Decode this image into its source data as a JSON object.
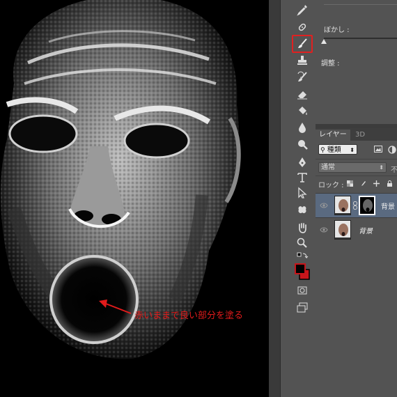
{
  "canvas": {
    "annotation": "赤いままで良い部分を塗る",
    "annotation_color": "#e21b1b"
  },
  "tools": [
    {
      "icon": "eyedropper-icon"
    },
    {
      "icon": "healing-brush-icon"
    },
    {
      "icon": "brush-icon",
      "active": true
    },
    {
      "icon": "clone-stamp-icon"
    },
    {
      "icon": "history-brush-icon"
    },
    {
      "icon": "eraser-icon"
    },
    {
      "icon": "paint-bucket-icon"
    },
    {
      "icon": "blur-drop-icon"
    },
    {
      "icon": "dodge-icon"
    },
    {
      "icon": "pen-icon"
    },
    {
      "icon": "type-icon"
    },
    {
      "icon": "path-selection-icon"
    },
    {
      "icon": "custom-shape-icon"
    },
    {
      "icon": "hand-icon"
    },
    {
      "icon": "zoom-icon"
    },
    {
      "icon": "color-swatches-icon"
    },
    {
      "icon": "quick-mask-icon"
    },
    {
      "icon": "screen-mode-icon"
    }
  ],
  "foreground_color": "#000000",
  "background_color": "#c8151b",
  "properties": {
    "blur_label": "ぼかし :",
    "adjust_label": "調整 :",
    "blur_value": 0
  },
  "layers_panel": {
    "tabs": [
      "レイヤー",
      "3D"
    ],
    "kind_filter": "種類",
    "blend_mode": "通常",
    "opacity_cut": "不",
    "lock_label": "ロック :",
    "layers": [
      {
        "name": "背景",
        "selected": true,
        "has_mask": true
      },
      {
        "name": "背景",
        "selected": false,
        "has_mask": false
      }
    ]
  }
}
